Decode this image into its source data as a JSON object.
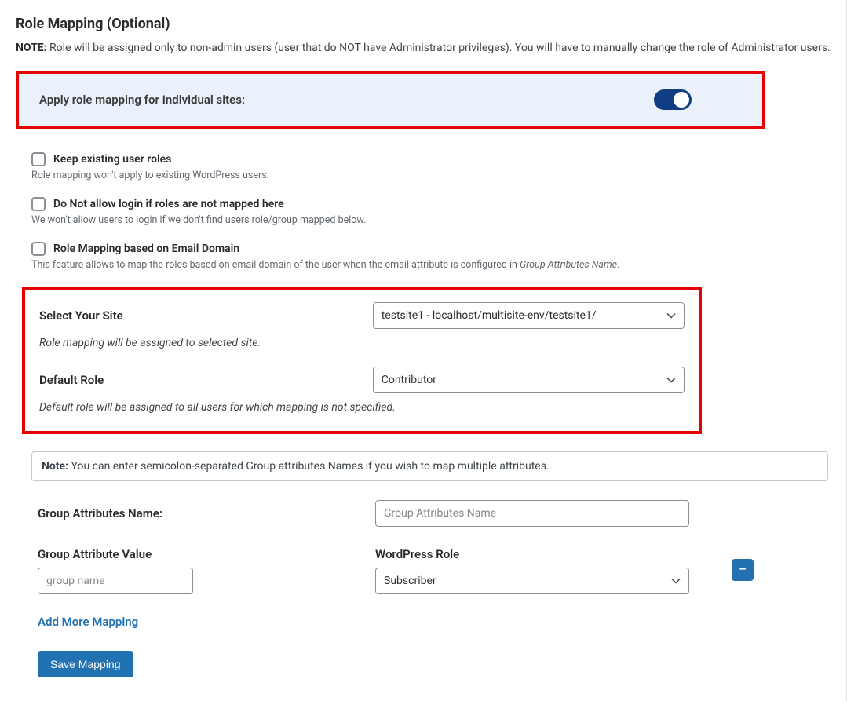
{
  "header": {
    "title": "Role Mapping (Optional)"
  },
  "note_top": {
    "prefix": "NOTE:",
    "text": " Role will be assigned only to non-admin users (user that do NOT have Administrator privileges). You will have to manually change the role of Administrator users."
  },
  "apply_panel": {
    "label": "Apply role mapping for Individual sites:",
    "enabled": true
  },
  "options": {
    "keep_existing": {
      "label": "Keep existing user roles",
      "help": "Role mapping won't apply to existing WordPress users."
    },
    "disallow_login": {
      "label": "Do Not allow login if roles are not mapped here",
      "help": "We won't allow users to login if we don't find users role/group mapped below."
    },
    "email_domain": {
      "label": "Role Mapping based on Email Domain",
      "help_before": "This feature allows to map the roles based on email domain of the user when the email attribute is configured in ",
      "help_em": "Group Attributes Name",
      "help_after": "."
    }
  },
  "site_block": {
    "select_label": "Select Your Site",
    "select_value": "testsite1 - localhost/multisite-env/testsite1/",
    "select_help": "Role mapping will be assigned to selected site.",
    "default_role_label": "Default Role",
    "default_role_value": "Contributor",
    "default_role_help": "Default role will be assigned to all users for which mapping is not specified."
  },
  "note_banner": {
    "prefix": "Note:",
    "text": " You can enter semicolon-separated Group attributes Names if you wish to map multiple attributes."
  },
  "attrs": {
    "name_label": "Group Attributes Name:",
    "name_placeholder": "Group Attributes Name",
    "value_label": "Group Attribute Value",
    "value_placeholder": "group name",
    "wp_role_label": "WordPress Role",
    "wp_role_value": "Subscriber"
  },
  "actions": {
    "add_more": "Add More Mapping",
    "save": "Save Mapping",
    "remove_glyph": "−"
  }
}
